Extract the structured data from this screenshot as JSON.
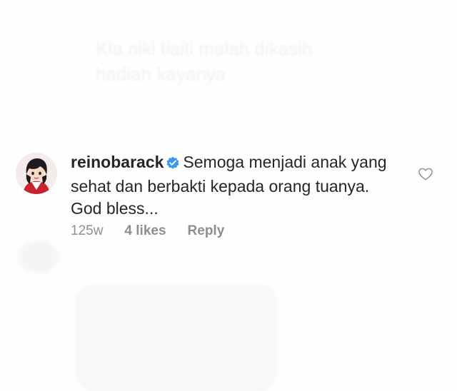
{
  "previous_comment": {
    "text": "Kla niki tiaiti malah dikasih hadiah kayanya"
  },
  "comment": {
    "username": "reinobarack",
    "text": "Semoga menjadi anak yang sehat dan berbakti kepada orang tuanya. God bless...",
    "time": "125w",
    "likes": "4 likes",
    "reply_label": "Reply"
  },
  "colors": {
    "text": "#262626",
    "meta": "#8e8e8e",
    "verified": "#3897f0"
  },
  "icons": {
    "verified": "verified-badge-icon",
    "like": "heart-outline-icon"
  }
}
